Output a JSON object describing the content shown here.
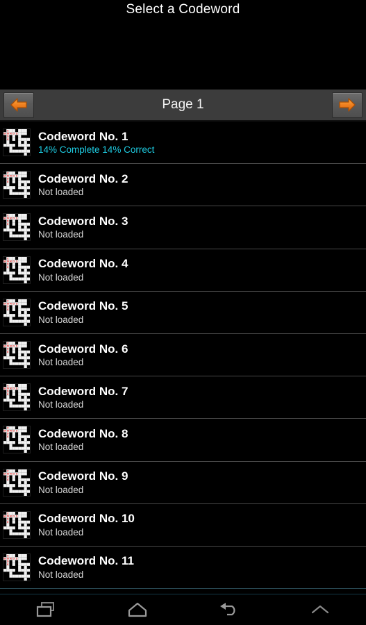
{
  "window": {
    "title": "Select a Codeword"
  },
  "pager": {
    "prev_icon": "left-arrow-icon",
    "next_icon": "right-arrow-icon",
    "label": "Page 1"
  },
  "list": {
    "thumbnail_icon": "codeword-grid-icon",
    "thumbnail_letters": {
      "vertical": "CODE",
      "horizontal": "WORDS"
    },
    "items": [
      {
        "title": "Codeword No. 1",
        "status": "14% Complete   14% Correct",
        "complete": "14% Complete",
        "correct": "14% Correct",
        "loaded": true
      },
      {
        "title": "Codeword No. 2",
        "status": "Not loaded",
        "loaded": false
      },
      {
        "title": "Codeword No. 3",
        "status": "Not loaded",
        "loaded": false
      },
      {
        "title": "Codeword No. 4",
        "status": "Not loaded",
        "loaded": false
      },
      {
        "title": "Codeword No. 5",
        "status": "Not loaded",
        "loaded": false
      },
      {
        "title": "Codeword No. 6",
        "status": "Not loaded",
        "loaded": false
      },
      {
        "title": "Codeword No. 7",
        "status": "Not loaded",
        "loaded": false
      },
      {
        "title": "Codeword No. 8",
        "status": "Not loaded",
        "loaded": false
      },
      {
        "title": "Codeword No. 9",
        "status": "Not loaded",
        "loaded": false
      },
      {
        "title": "Codeword No. 10",
        "status": "Not loaded",
        "loaded": false
      },
      {
        "title": "Codeword No. 11",
        "status": "Not loaded",
        "loaded": false
      }
    ]
  },
  "navbar": {
    "buttons": [
      {
        "name": "recent-apps-icon"
      },
      {
        "name": "home-icon"
      },
      {
        "name": "back-icon"
      },
      {
        "name": "chevron-up-icon"
      }
    ]
  },
  "colors": {
    "background": "#000000",
    "pager_bar": "#3c3c3c",
    "accent_orange": "#f08020",
    "progress_text": "#1ecbe1",
    "divider": "#4a4a4a",
    "thumb_letter_red": "#e82c2c"
  }
}
